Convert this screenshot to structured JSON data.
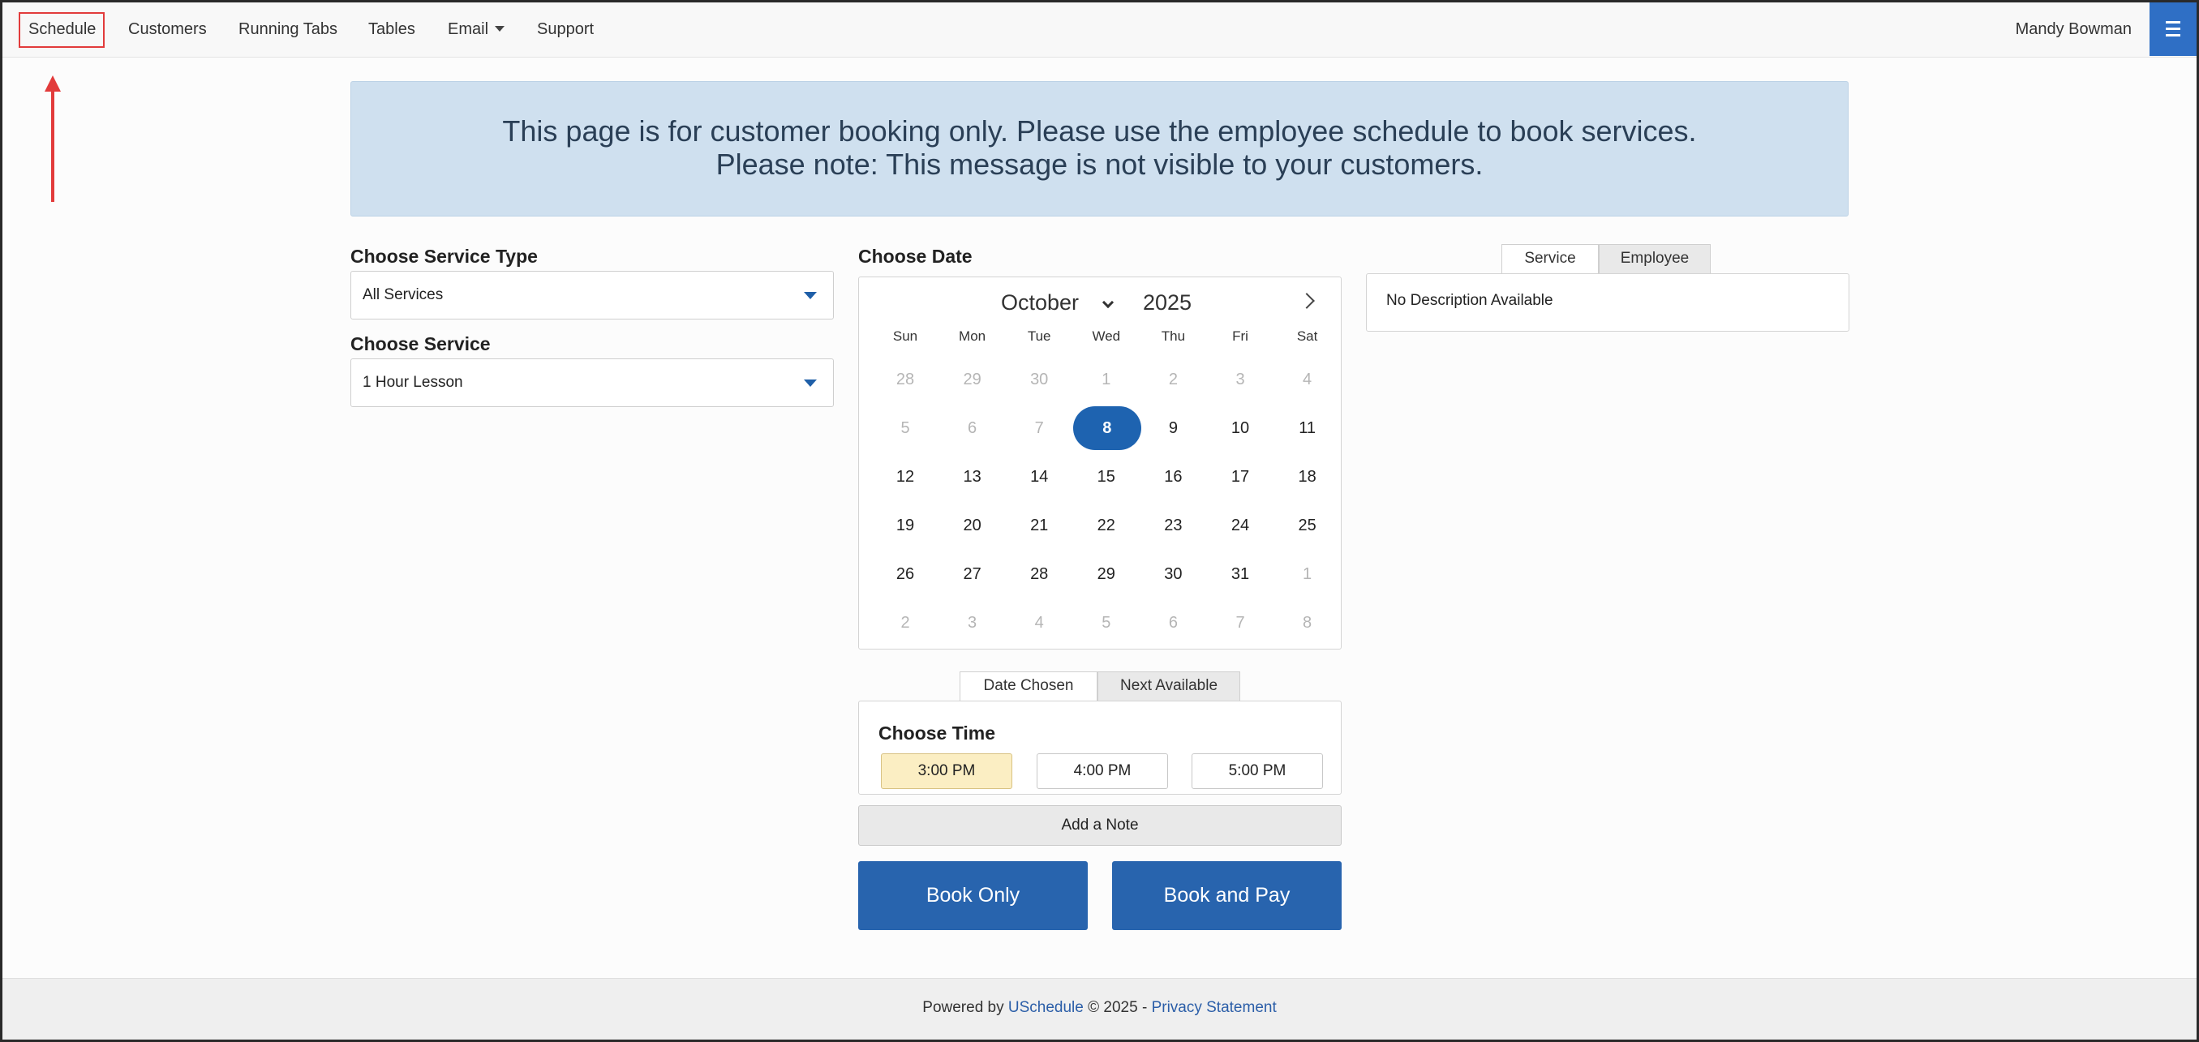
{
  "nav": {
    "items": [
      {
        "label": "Schedule"
      },
      {
        "label": "Customers"
      },
      {
        "label": "Running Tabs"
      },
      {
        "label": "Tables"
      },
      {
        "label": "Email"
      },
      {
        "label": "Support"
      }
    ],
    "user": "Mandy Bowman",
    "menu_icon": "hamburger-icon"
  },
  "banner": {
    "line1": "This page is for customer booking only. Please use the employee schedule to book services.",
    "line2": "Please note: This message is not visible to your customers."
  },
  "service_type": {
    "label": "Choose Service Type",
    "value": "All Services"
  },
  "service": {
    "label": "Choose Service",
    "value": "1 Hour Lesson"
  },
  "date": {
    "label": "Choose Date",
    "month": "October",
    "year": "2025",
    "weekdays": [
      "Sun",
      "Mon",
      "Tue",
      "Wed",
      "Thu",
      "Fri",
      "Sat"
    ],
    "selected_day": "8",
    "weeks": [
      [
        {
          "d": "28",
          "m": true
        },
        {
          "d": "29",
          "m": true
        },
        {
          "d": "30",
          "m": true
        },
        {
          "d": "1",
          "m": true
        },
        {
          "d": "2",
          "m": true
        },
        {
          "d": "3",
          "m": true
        },
        {
          "d": "4",
          "m": true
        }
      ],
      [
        {
          "d": "5",
          "m": true
        },
        {
          "d": "6",
          "m": true
        },
        {
          "d": "7",
          "m": true
        },
        {
          "d": "8",
          "m": false,
          "s": true
        },
        {
          "d": "9",
          "m": false
        },
        {
          "d": "10",
          "m": false
        },
        {
          "d": "11",
          "m": false
        }
      ],
      [
        {
          "d": "12",
          "m": false
        },
        {
          "d": "13",
          "m": false
        },
        {
          "d": "14",
          "m": false
        },
        {
          "d": "15",
          "m": false
        },
        {
          "d": "16",
          "m": false
        },
        {
          "d": "17",
          "m": false
        },
        {
          "d": "18",
          "m": false
        }
      ],
      [
        {
          "d": "19",
          "m": false
        },
        {
          "d": "20",
          "m": false
        },
        {
          "d": "21",
          "m": false
        },
        {
          "d": "22",
          "m": false
        },
        {
          "d": "23",
          "m": false
        },
        {
          "d": "24",
          "m": false
        },
        {
          "d": "25",
          "m": false
        }
      ],
      [
        {
          "d": "26",
          "m": false
        },
        {
          "d": "27",
          "m": false
        },
        {
          "d": "28",
          "m": false
        },
        {
          "d": "29",
          "m": false
        },
        {
          "d": "30",
          "m": false
        },
        {
          "d": "31",
          "m": false
        },
        {
          "d": "1",
          "m": true
        }
      ],
      [
        {
          "d": "2",
          "m": true
        },
        {
          "d": "3",
          "m": true
        },
        {
          "d": "4",
          "m": true
        },
        {
          "d": "5",
          "m": true
        },
        {
          "d": "6",
          "m": true
        },
        {
          "d": "7",
          "m": true
        },
        {
          "d": "8",
          "m": true
        }
      ]
    ]
  },
  "info_tabs": {
    "service": "Service",
    "employee": "Employee",
    "active": "Service",
    "description": "No Description Available"
  },
  "time_tabs": {
    "date_chosen": "Date Chosen",
    "next_available": "Next Available",
    "active": "Date Chosen"
  },
  "time": {
    "label": "Choose Time",
    "slots": [
      "3:00 PM",
      "4:00 PM",
      "5:00 PM"
    ],
    "selected": "3:00 PM"
  },
  "add_note": "Add a Note",
  "actions": {
    "book_only": "Book Only",
    "book_and_pay": "Book and Pay"
  },
  "footer": {
    "prefix": "Powered by ",
    "brand": "USchedule",
    "copyright": " © 2025 - ",
    "privacy": "Privacy Statement"
  },
  "colors": {
    "accent": "#2864ae",
    "highlight": "#e23b3b",
    "banner_bg": "#cfe0ef",
    "selected_time": "#fbeec3"
  }
}
